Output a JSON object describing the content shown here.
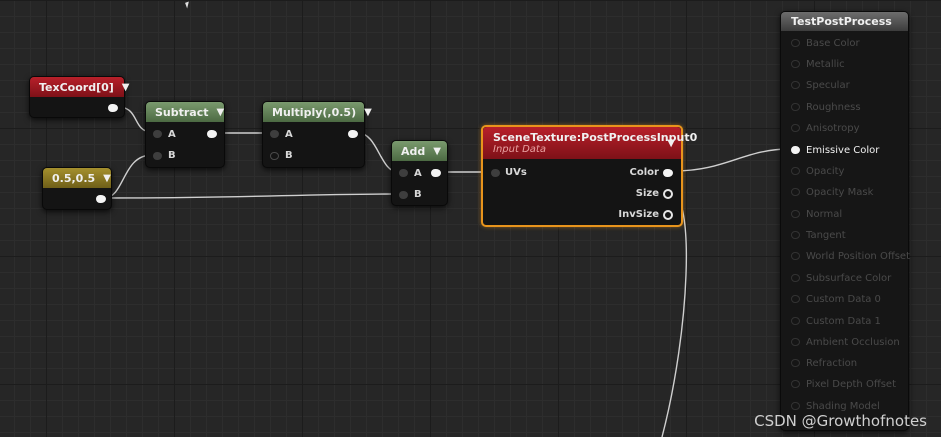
{
  "nodes": {
    "texcoord": {
      "title": "TexCoord[0]"
    },
    "constant": {
      "title": "0.5,0.5"
    },
    "subtract": {
      "title": "Subtract",
      "pin_a": "A",
      "pin_b": "B"
    },
    "multiply": {
      "title": "Multiply(,0.5)",
      "pin_a": "A",
      "pin_b": "B"
    },
    "add": {
      "title": "Add",
      "pin_a": "A",
      "pin_b": "B"
    },
    "scenetexture": {
      "title": "SceneTexture:PostProcessInput0",
      "subtitle": "Input Data",
      "input_uvs": "UVs",
      "out_color": "Color",
      "out_size": "Size",
      "out_invsize": "InvSize"
    }
  },
  "result_node": {
    "title": "TestPostProcess",
    "inputs": [
      "Base Color",
      "Metallic",
      "Specular",
      "Roughness",
      "Anisotropy",
      "Emissive Color",
      "Opacity",
      "Opacity Mask",
      "Normal",
      "Tangent",
      "World Position Offset",
      "Subsurface Color",
      "Custom Data 0",
      "Custom Data 1",
      "Ambient Occlusion",
      "Refraction",
      "Pixel Depth Offset",
      "Shading Model"
    ],
    "active_input": "Emissive Color"
  },
  "icons": {
    "dropdown": "chevron-down-icon"
  },
  "colors": {
    "selection_outline": "#e8941c",
    "wire": "#cfcfcf"
  },
  "watermark": "CSDN @Growthofnotes"
}
